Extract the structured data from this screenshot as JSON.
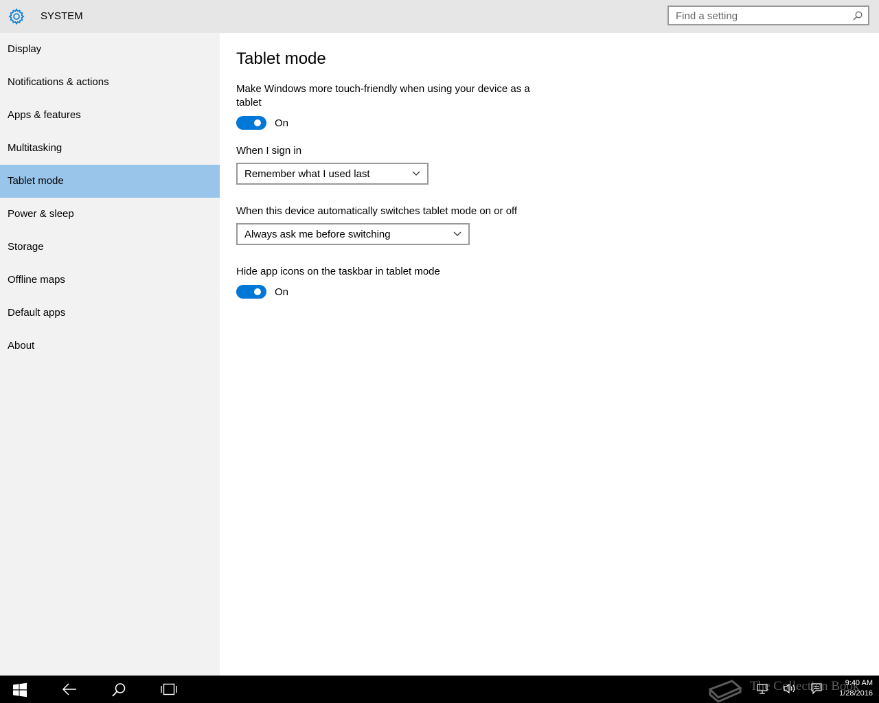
{
  "header": {
    "title": "SYSTEM",
    "search_placeholder": "Find a setting"
  },
  "sidebar": {
    "items": [
      {
        "label": "Display"
      },
      {
        "label": "Notifications & actions"
      },
      {
        "label": "Apps & features"
      },
      {
        "label": "Multitasking"
      },
      {
        "label": "Tablet mode",
        "active": true
      },
      {
        "label": "Power & sleep"
      },
      {
        "label": "Storage"
      },
      {
        "label": "Offline maps"
      },
      {
        "label": "Default apps"
      },
      {
        "label": "About"
      }
    ]
  },
  "main": {
    "title": "Tablet mode",
    "touch_friendly": {
      "label_line1": "Make Windows more touch-friendly when using your device as a",
      "label_line2": "tablet",
      "state": "On"
    },
    "sign_in": {
      "label": "When I sign in",
      "value": "Remember what I used last"
    },
    "auto_switch": {
      "label": "When this device automatically switches tablet mode on or off",
      "value": "Always ask me before switching"
    },
    "hide_icons": {
      "label": "Hide app icons on the taskbar in tablet mode",
      "state": "On"
    }
  },
  "taskbar": {
    "watermark": "The Collection Book",
    "time": "9:40 AM",
    "date": "1/28/2016"
  },
  "colors": {
    "accent": "#0078d7",
    "sidebar_active": "#99c5ea",
    "header_bg": "#e6e6e6",
    "sidebar_bg": "#f2f2f2"
  }
}
